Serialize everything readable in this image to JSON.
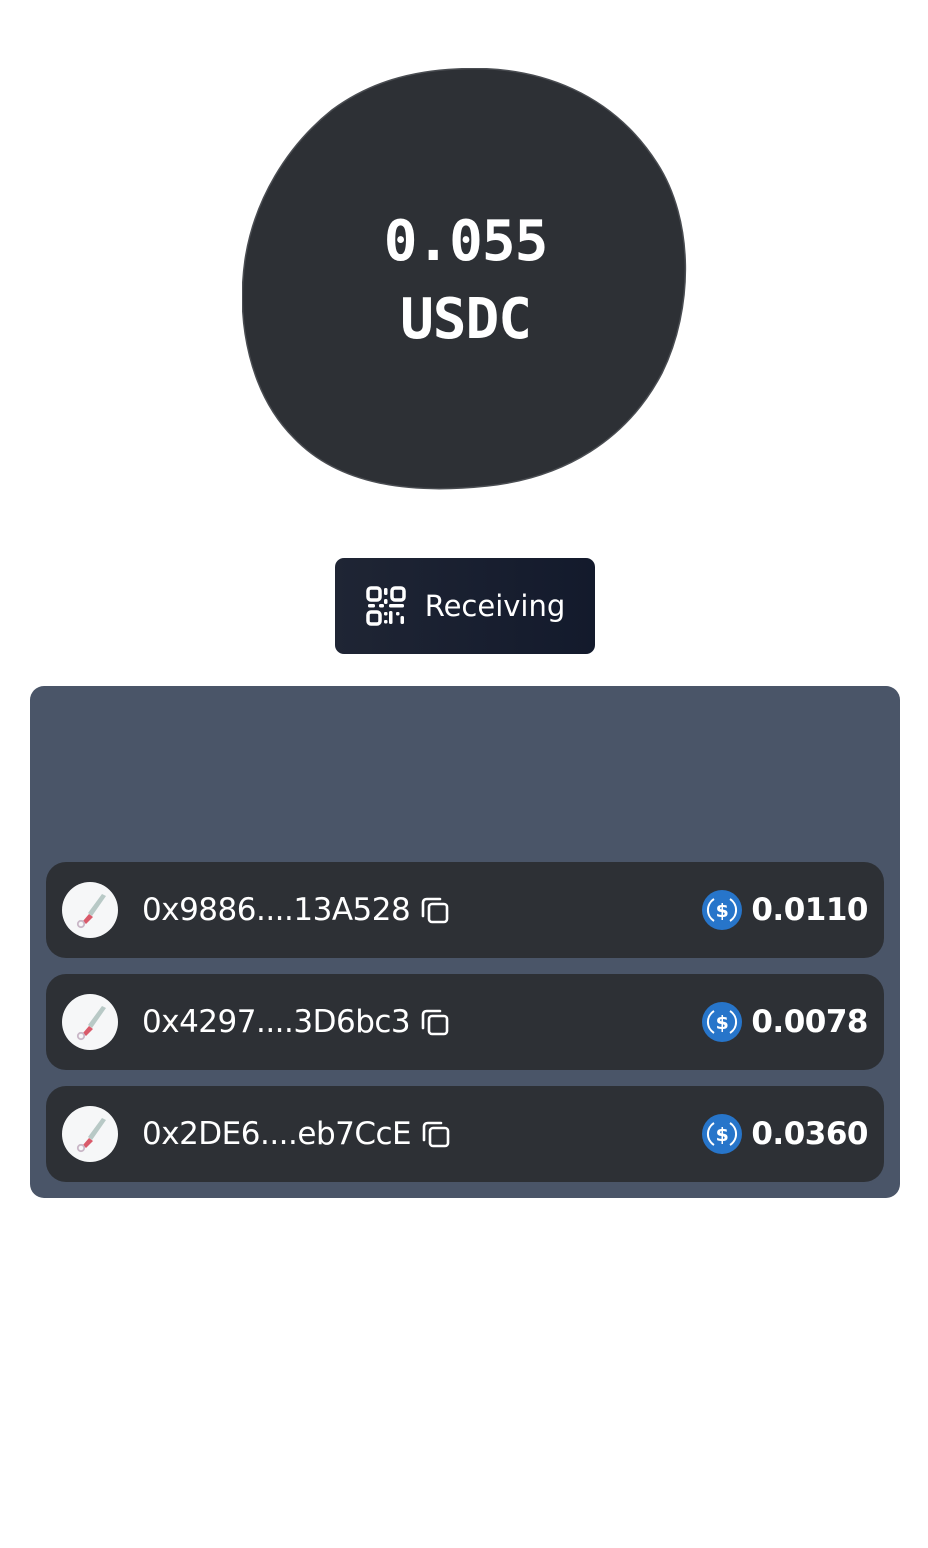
{
  "balance": {
    "amount": "0.055",
    "unit": "USDC"
  },
  "receive_button": {
    "label": "Receiving",
    "icon": "qr-code-icon"
  },
  "payments": [
    {
      "address": "0x9886....13A528",
      "amount": "0.0110",
      "token_icon": "usdc-icon",
      "copy_icon": "copy-icon"
    },
    {
      "address": "0x4297....3D6bc3",
      "amount": "0.0078",
      "token_icon": "usdc-icon",
      "copy_icon": "copy-icon"
    },
    {
      "address": "0x2DE6....eb7CcE",
      "amount": "0.0360",
      "token_icon": "usdc-icon",
      "copy_icon": "copy-icon"
    }
  ],
  "colors": {
    "blob": "#2d3035",
    "panel": "#4a5568",
    "row": "#2d3035",
    "button": "#1a2030",
    "usdc": "#2775ca"
  }
}
